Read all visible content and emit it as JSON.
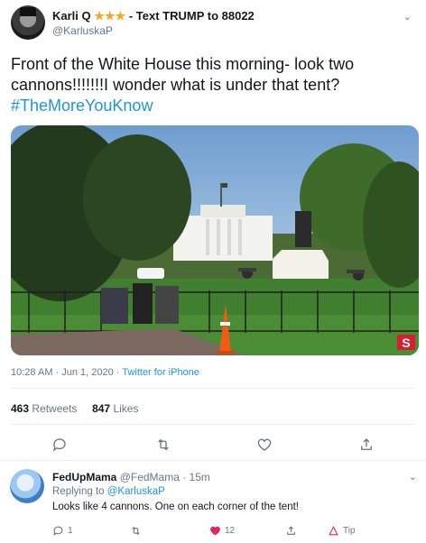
{
  "tweet": {
    "author_name": "Karli Q",
    "stars": "★★★",
    "author_suffix": " - Text TRUMP to 88022",
    "handle": "@KarluskaP",
    "text_line1": "Front of the White House this morning- look two",
    "text_line2": "cannons!!!!!!!I wonder what is under that tent?",
    "hashtag": "#TheMoreYouKnow",
    "time": "10:28 AM · Jun 1, 2020 · ",
    "source": "Twitter for iPhone",
    "retweets_count": "463",
    "retweets_label": "Retweets",
    "likes_count": "847",
    "likes_label": "Likes",
    "media_badge": "S"
  },
  "reply": {
    "name": "FedUpMama",
    "handle_time": "@FedMama · 15m",
    "replying_prefix": "Replying to ",
    "replying_handle": "@KarluskaP",
    "text": "Looks like 4 cannons. One on each corner of the tent!",
    "reply_count": "1",
    "like_count": "12",
    "tip_label": "Tip"
  },
  "colors": {
    "accent": "#1b95e0",
    "heart": "#e0245e",
    "star": "#f5a623"
  },
  "icons": [
    "reply-icon",
    "retweet-icon",
    "like-icon",
    "share-icon",
    "tip-icon",
    "chevron-down-icon"
  ]
}
